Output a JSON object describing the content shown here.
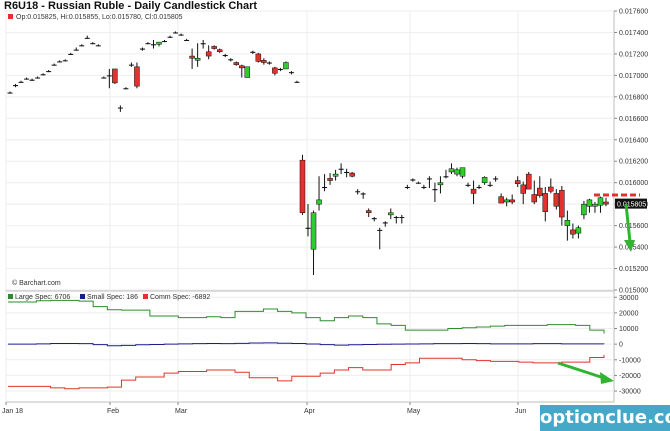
{
  "title": "R6U18 - Russian Ruble - Daily Candlestick Chart",
  "colors": {
    "up": "#2ecc2e",
    "down": "#e0332b",
    "large": "#2e8b2e",
    "small": "#1c1c8c",
    "comm": "#e0332b",
    "watermark": "#46a8c8",
    "arrow": "#32b432"
  },
  "chart_data": [
    {
      "type": "candlestick",
      "ohlc_label": "Op:0.015825, Hi:0.015855, Lo:0.015780, Cl:0.015805",
      "credit": "© Barchart.com",
      "y_ticks": [
        "0.017600",
        "0.017400",
        "0.017200",
        "0.017000",
        "0.016800",
        "0.016600",
        "0.016400",
        "0.016200",
        "0.016000",
        "0.015800",
        "0.015600",
        "0.015400",
        "0.015200",
        "0.015000"
      ],
      "ylim": [
        0.015,
        0.0176
      ],
      "last_price": "0.015805",
      "x_ticks": [
        "Jan 18",
        "Feb",
        "Mar",
        "Apr",
        "May",
        "Jun"
      ],
      "candles": [
        [
          0.01684,
          0.01685,
          0.01683,
          0.01684
        ],
        [
          0.0169,
          0.01692,
          0.01689,
          0.01691
        ],
        [
          0.01694,
          0.01695,
          0.01693,
          0.01694
        ],
        [
          0.01697,
          0.01698,
          0.01696,
          0.01697
        ],
        [
          0.01696,
          0.01697,
          0.01695,
          0.01695
        ],
        [
          0.01698,
          0.01699,
          0.01697,
          0.01698
        ],
        [
          0.01701,
          0.01702,
          0.017,
          0.01701
        ],
        [
          0.01704,
          0.01705,
          0.01703,
          0.01704
        ],
        [
          0.0171,
          0.01711,
          0.01709,
          0.0171
        ],
        [
          0.01713,
          0.01714,
          0.01712,
          0.01713
        ],
        [
          0.01714,
          0.01715,
          0.01713,
          0.01714
        ],
        [
          0.0172,
          0.01721,
          0.01719,
          0.0172
        ],
        [
          0.01724,
          0.01726,
          0.01723,
          0.01724
        ],
        [
          0.01728,
          0.01729,
          0.01727,
          0.01728
        ],
        [
          0.01735,
          0.01737,
          0.01734,
          0.01735
        ],
        [
          0.0173,
          0.01731,
          0.01729,
          0.0173
        ],
        [
          0.01728,
          0.01729,
          0.01727,
          0.01728
        ],
        [
          0.01698,
          0.01699,
          0.01697,
          0.01698
        ],
        [
          0.017,
          0.01706,
          0.01688,
          0.017
        ],
        [
          0.01706,
          0.01706,
          0.01692,
          0.01693
        ],
        [
          0.0167,
          0.01672,
          0.01666,
          0.0167
        ],
        [
          0.01688,
          0.01689,
          0.01687,
          0.01688
        ],
        [
          0.0171,
          0.01712,
          0.01708,
          0.0171
        ],
        [
          0.01708,
          0.01712,
          0.01688,
          0.0169
        ],
        [
          0.01724,
          0.01726,
          0.01723,
          0.01725
        ],
        [
          0.0173,
          0.01731,
          0.01729,
          0.0173
        ],
        [
          0.01728,
          0.01733,
          0.01725,
          0.01729
        ],
        [
          0.01729,
          0.0173,
          0.01727,
          0.01731
        ],
        [
          0.01732,
          0.01733,
          0.01731,
          0.01732
        ],
        [
          0.01736,
          0.01737,
          0.01735,
          0.01736
        ],
        [
          0.0174,
          0.01741,
          0.01739,
          0.0174
        ],
        [
          0.01738,
          0.01739,
          0.01737,
          0.01738
        ],
        [
          0.01733,
          0.01734,
          0.01732,
          0.01733
        ],
        [
          0.01718,
          0.01725,
          0.01706,
          0.01716
        ],
        [
          0.01714,
          0.0173,
          0.01708,
          0.01716
        ],
        [
          0.01729,
          0.01733,
          0.01725,
          0.0173
        ],
        [
          0.01722,
          0.01728,
          0.01715,
          0.01718
        ],
        [
          0.01727,
          0.01728,
          0.01724,
          0.01725
        ],
        [
          0.01724,
          0.01725,
          0.01721,
          0.01722
        ],
        [
          0.01719,
          0.0172,
          0.01717,
          0.01718
        ],
        [
          0.01715,
          0.01716,
          0.01713,
          0.01714
        ],
        [
          0.01712,
          0.01713,
          0.01709,
          0.0171
        ],
        [
          0.01709,
          0.0171,
          0.01698,
          0.01707
        ],
        [
          0.01698,
          0.01708,
          0.01698,
          0.01708
        ],
        [
          0.01722,
          0.01723,
          0.0172,
          0.01721
        ],
        [
          0.0172,
          0.01721,
          0.01712,
          0.01713
        ],
        [
          0.01714,
          0.01716,
          0.0171,
          0.01712
        ],
        [
          0.01712,
          0.01713,
          0.0171,
          0.01711
        ],
        [
          0.01707,
          0.01708,
          0.017,
          0.01702
        ],
        [
          0.01705,
          0.01707,
          0.01704,
          0.01706
        ],
        [
          0.01706,
          0.01713,
          0.01706,
          0.01712
        ],
        [
          0.01703,
          0.01704,
          0.01701,
          0.01703
        ],
        [
          0.01694,
          0.01695,
          0.01693,
          0.01694
        ],
        [
          0.01621,
          0.01626,
          0.0157,
          0.01572
        ],
        [
          0.01558,
          0.0158,
          0.0155,
          0.01557
        ],
        [
          0.01538,
          0.01574,
          0.01514,
          0.01572
        ],
        [
          0.0158,
          0.01606,
          0.01574,
          0.01584
        ],
        [
          0.01595,
          0.01608,
          0.01592,
          0.01596
        ],
        [
          0.01604,
          0.01609,
          0.01598,
          0.01602
        ],
        [
          0.01606,
          0.01612,
          0.01602,
          0.01608
        ],
        [
          0.01612,
          0.01618,
          0.01608,
          0.01613
        ],
        [
          0.0161,
          0.01613,
          0.01605,
          0.01609
        ],
        [
          0.01609,
          0.0161,
          0.01605,
          0.01606
        ],
        [
          0.01592,
          0.01594,
          0.01589,
          0.01592
        ],
        [
          0.0159,
          0.01591,
          0.01585,
          0.01589
        ],
        [
          0.01574,
          0.01576,
          0.01568,
          0.01572
        ],
        [
          0.01567,
          0.01568,
          0.01564,
          0.01566
        ],
        [
          0.01556,
          0.01558,
          0.01538,
          0.01556
        ],
        [
          0.01562,
          0.01564,
          0.01559,
          0.01563
        ],
        [
          0.0157,
          0.01576,
          0.01566,
          0.01572
        ],
        [
          0.01568,
          0.01569,
          0.01562,
          0.01568
        ],
        [
          0.01568,
          0.0157,
          0.01562,
          0.01568
        ],
        [
          0.01596,
          0.01598,
          0.01594,
          0.01596
        ],
        [
          0.01602,
          0.01604,
          0.01601,
          0.01603
        ],
        [
          0.016,
          0.01601,
          0.01599,
          0.016
        ],
        [
          0.01596,
          0.01598,
          0.01594,
          0.01596
        ],
        [
          0.01604,
          0.01606,
          0.01595,
          0.01603
        ],
        [
          0.01593,
          0.016,
          0.01582,
          0.01594
        ],
        [
          0.01598,
          0.01606,
          0.0159,
          0.016
        ],
        [
          0.01606,
          0.01612,
          0.01604,
          0.01605
        ],
        [
          0.0161,
          0.01618,
          0.01608,
          0.01613
        ],
        [
          0.01608,
          0.01614,
          0.01606,
          0.01612
        ],
        [
          0.01606,
          0.01612,
          0.01604,
          0.01614
        ],
        [
          0.01598,
          0.016,
          0.01596,
          0.01598
        ],
        [
          0.01594,
          0.01602,
          0.0158,
          0.0159
        ],
        [
          0.01596,
          0.01598,
          0.01594,
          0.01596
        ],
        [
          0.016,
          0.01606,
          0.01598,
          0.01605
        ],
        [
          0.01598,
          0.01601,
          0.01596,
          0.01598
        ],
        [
          0.01604,
          0.01606,
          0.01601,
          0.01603
        ],
        [
          0.01587,
          0.0159,
          0.01582,
          0.01581
        ],
        [
          0.01582,
          0.01586,
          0.01578,
          0.01584
        ],
        [
          0.01584,
          0.01589,
          0.0158,
          0.01582
        ],
        [
          0.01602,
          0.01606,
          0.01596,
          0.01599
        ],
        [
          0.01598,
          0.01601,
          0.0158,
          0.0159
        ],
        [
          0.01608,
          0.0161,
          0.016,
          0.01594
        ],
        [
          0.01589,
          0.01602,
          0.0158,
          0.01582
        ],
        [
          0.01595,
          0.01606,
          0.01586,
          0.01588
        ],
        [
          0.0159,
          0.01596,
          0.01564,
          0.01573
        ],
        [
          0.01596,
          0.01604,
          0.0159,
          0.01592
        ],
        [
          0.0159,
          0.01594,
          0.01575,
          0.01578
        ],
        [
          0.01593,
          0.01597,
          0.0156,
          0.01568
        ],
        [
          0.0156,
          0.01574,
          0.01546,
          0.01565
        ],
        [
          0.01556,
          0.01562,
          0.01548,
          0.01552
        ],
        [
          0.01553,
          0.0156,
          0.01548,
          0.01558
        ],
        [
          0.0157,
          0.01583,
          0.01566,
          0.0158
        ],
        [
          0.01578,
          0.01585,
          0.01572,
          0.01584
        ],
        [
          0.01578,
          0.01582,
          0.01572,
          0.0158
        ],
        [
          0.01579,
          0.01587,
          0.01572,
          0.01586
        ],
        [
          0.01582,
          0.01586,
          0.01578,
          0.0158
        ]
      ],
      "dashed_line_value": 0.015885
    },
    {
      "type": "step-line",
      "legend": [
        "Large Spec: 6706",
        "Small Spec: 186",
        "Comm Spec: -6892"
      ],
      "y_ticks": [
        "30000",
        "20000",
        "10000",
        "0",
        "-10000",
        "-20000",
        "-30000"
      ],
      "ylim": [
        -37000,
        34000
      ],
      "series": [
        {
          "name": "Large Spec",
          "values": [
            27000,
            27000,
            27800,
            28000,
            28000,
            27500,
            24000,
            22000,
            21800,
            21800,
            18000,
            18000,
            17000,
            17000,
            17500,
            17000,
            21000,
            21000,
            22500,
            21000,
            20000,
            17000,
            15000,
            17000,
            18000,
            17000,
            13000,
            12000,
            9000,
            9000,
            9000,
            10000,
            10500,
            11000,
            11500,
            12000,
            12000,
            12000,
            12500,
            12500,
            12000,
            9000,
            6706
          ]
        },
        {
          "name": "Small Spec",
          "values": [
            0,
            0,
            200,
            400,
            400,
            300,
            -300,
            -1000,
            -800,
            -400,
            -200,
            0,
            200,
            300,
            400,
            300,
            500,
            700,
            800,
            600,
            400,
            100,
            -300,
            -600,
            -400,
            -200,
            -100,
            0,
            100,
            200,
            300,
            300,
            400,
            300,
            200,
            200,
            200,
            300,
            300,
            200,
            200,
            200,
            186
          ]
        },
        {
          "name": "Comm Spec",
          "values": [
            -27000,
            -27000,
            -27000,
            -28000,
            -28500,
            -28000,
            -28000,
            -27500,
            -23000,
            -21000,
            -21000,
            -18500,
            -17500,
            -17500,
            -16500,
            -16500,
            -18000,
            -21500,
            -21500,
            -23500,
            -20500,
            -20500,
            -18500,
            -16500,
            -15000,
            -16500,
            -16500,
            -13000,
            -12000,
            -9000,
            -9000,
            -9000,
            -10000,
            -10500,
            -11000,
            -11000,
            -11500,
            -12000,
            -12000,
            -11500,
            -11500,
            -8500,
            -6892
          ]
        }
      ]
    }
  ]
}
